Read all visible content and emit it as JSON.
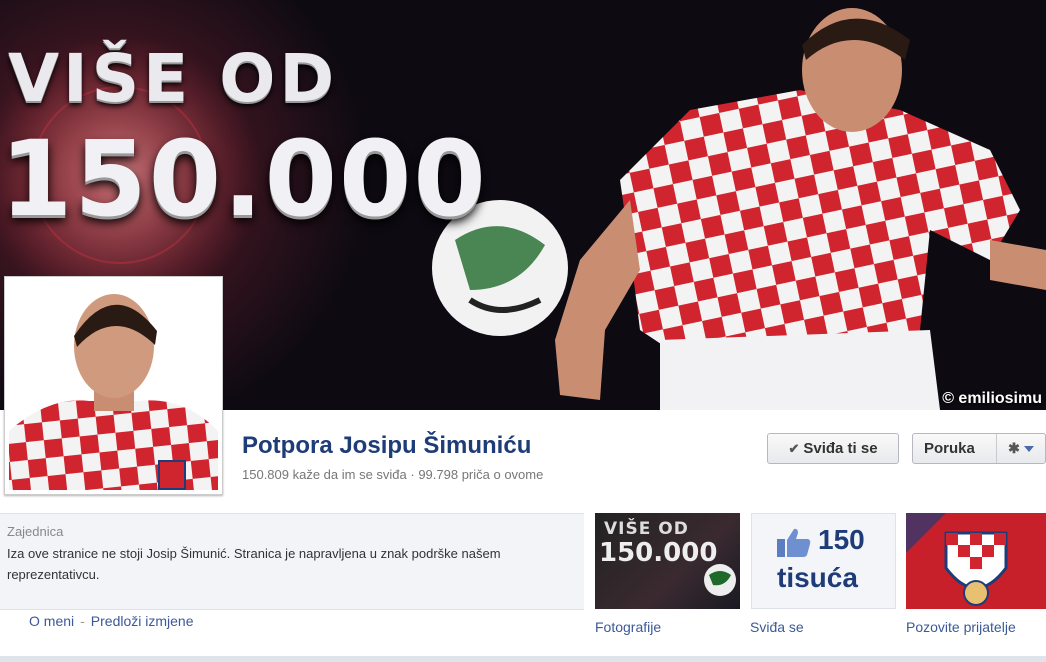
{
  "cover": {
    "line1": "VIŠE OD",
    "line2": "150.000",
    "watermark": "© emiliosimu"
  },
  "page": {
    "title": "Potpora Josipu Šimuniću",
    "stats": "150.809 kaže da im se sviđa · 99.798 priča o ovome"
  },
  "actions": {
    "like_label": "Sviđa ti se",
    "message_label": "Poruka",
    "like_icon": "checkmark-icon",
    "settings_icon": "gear-icon"
  },
  "about": {
    "category": "Zajednica",
    "text": "Iza ove stranice ne stoji Josip Šimunić. Stranica je napravljena u znak podrške našem reprezentativcu.",
    "links": [
      "O meni",
      "Predloži izmjene"
    ]
  },
  "tiles": [
    {
      "label": "Fotografije",
      "line1": "VIŠE OD",
      "line2": "150.000"
    },
    {
      "label": "Sviđa se",
      "number": "150",
      "subtitle": "tisuća",
      "icon": "thumbs-up-icon"
    },
    {
      "label": "Pozovite prijatelje"
    }
  ],
  "colors": {
    "link": "#3b5998",
    "title": "#1d3c78",
    "croatia_red": "#c8202a"
  }
}
